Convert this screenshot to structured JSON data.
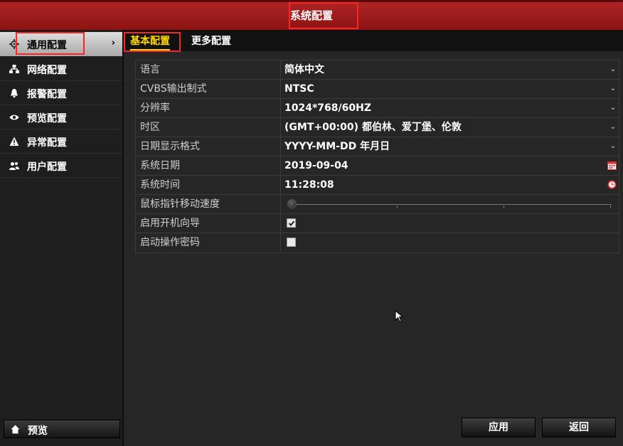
{
  "window": {
    "title": "系统配置"
  },
  "sidebar": {
    "items": [
      {
        "label": "通用配置",
        "icon": "gear-icon",
        "active": true
      },
      {
        "label": "网络配置",
        "icon": "network-icon"
      },
      {
        "label": "报警配置",
        "icon": "alarm-icon"
      },
      {
        "label": "预览配置",
        "icon": "eye-icon"
      },
      {
        "label": "异常配置",
        "icon": "warning-icon"
      },
      {
        "label": "用户配置",
        "icon": "users-icon"
      }
    ],
    "chevron": "›",
    "preview_label": "预览"
  },
  "tabs": [
    {
      "label": "基本配置",
      "active": true
    },
    {
      "label": "更多配置"
    }
  ],
  "form": {
    "rows": [
      {
        "label": "语言",
        "value": "简体中文",
        "control": "dropdown"
      },
      {
        "label": "CVBS输出制式",
        "value": "NTSC",
        "control": "dropdown"
      },
      {
        "label": "分辨率",
        "value": "1024*768/60HZ",
        "control": "dropdown"
      },
      {
        "label": "时区",
        "value": "(GMT+00:00) 都伯林、爱丁堡、伦敦",
        "control": "dropdown"
      },
      {
        "label": "日期显示格式",
        "value": "YYYY-MM-DD 年月日",
        "control": "dropdown"
      },
      {
        "label": "系统日期",
        "value": "2019-09-04",
        "control": "date"
      },
      {
        "label": "系统时间",
        "value": "11:28:08",
        "control": "time"
      },
      {
        "label": "鼠标指针移动速度",
        "control": "slider",
        "level": 0
      },
      {
        "label": "启用开机向导",
        "control": "checkbox",
        "checked": true
      },
      {
        "label": "启动操作密码",
        "control": "checkbox",
        "checked": false
      }
    ]
  },
  "buttons": {
    "apply": "应用",
    "back": "返回"
  },
  "colors": {
    "title_bar": "#a01c1c",
    "active_tab": "#ffd800",
    "highlight_box": "#ff2424"
  }
}
